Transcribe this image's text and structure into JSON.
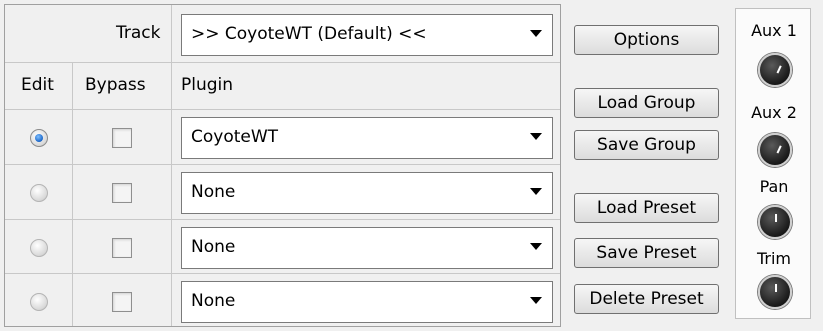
{
  "track": {
    "label": "Track",
    "value": ">> CoyoteWT (Default) <<"
  },
  "columns": {
    "edit": "Edit",
    "bypass": "Bypass",
    "plugin": "Plugin"
  },
  "rows": [
    {
      "edit_selected": true,
      "plugin": "CoyoteWT"
    },
    {
      "edit_selected": false,
      "plugin": "None"
    },
    {
      "edit_selected": false,
      "plugin": "None"
    },
    {
      "edit_selected": false,
      "plugin": "None"
    }
  ],
  "buttons": {
    "options": "Options",
    "load_group": "Load Group",
    "save_group": "Save Group",
    "load_preset": "Load Preset",
    "save_preset": "Save Preset",
    "delete_preset": "Delete Preset"
  },
  "knobs": {
    "aux1": "Aux 1",
    "aux2": "Aux 2",
    "pan": "Pan",
    "trim": "Trim"
  }
}
